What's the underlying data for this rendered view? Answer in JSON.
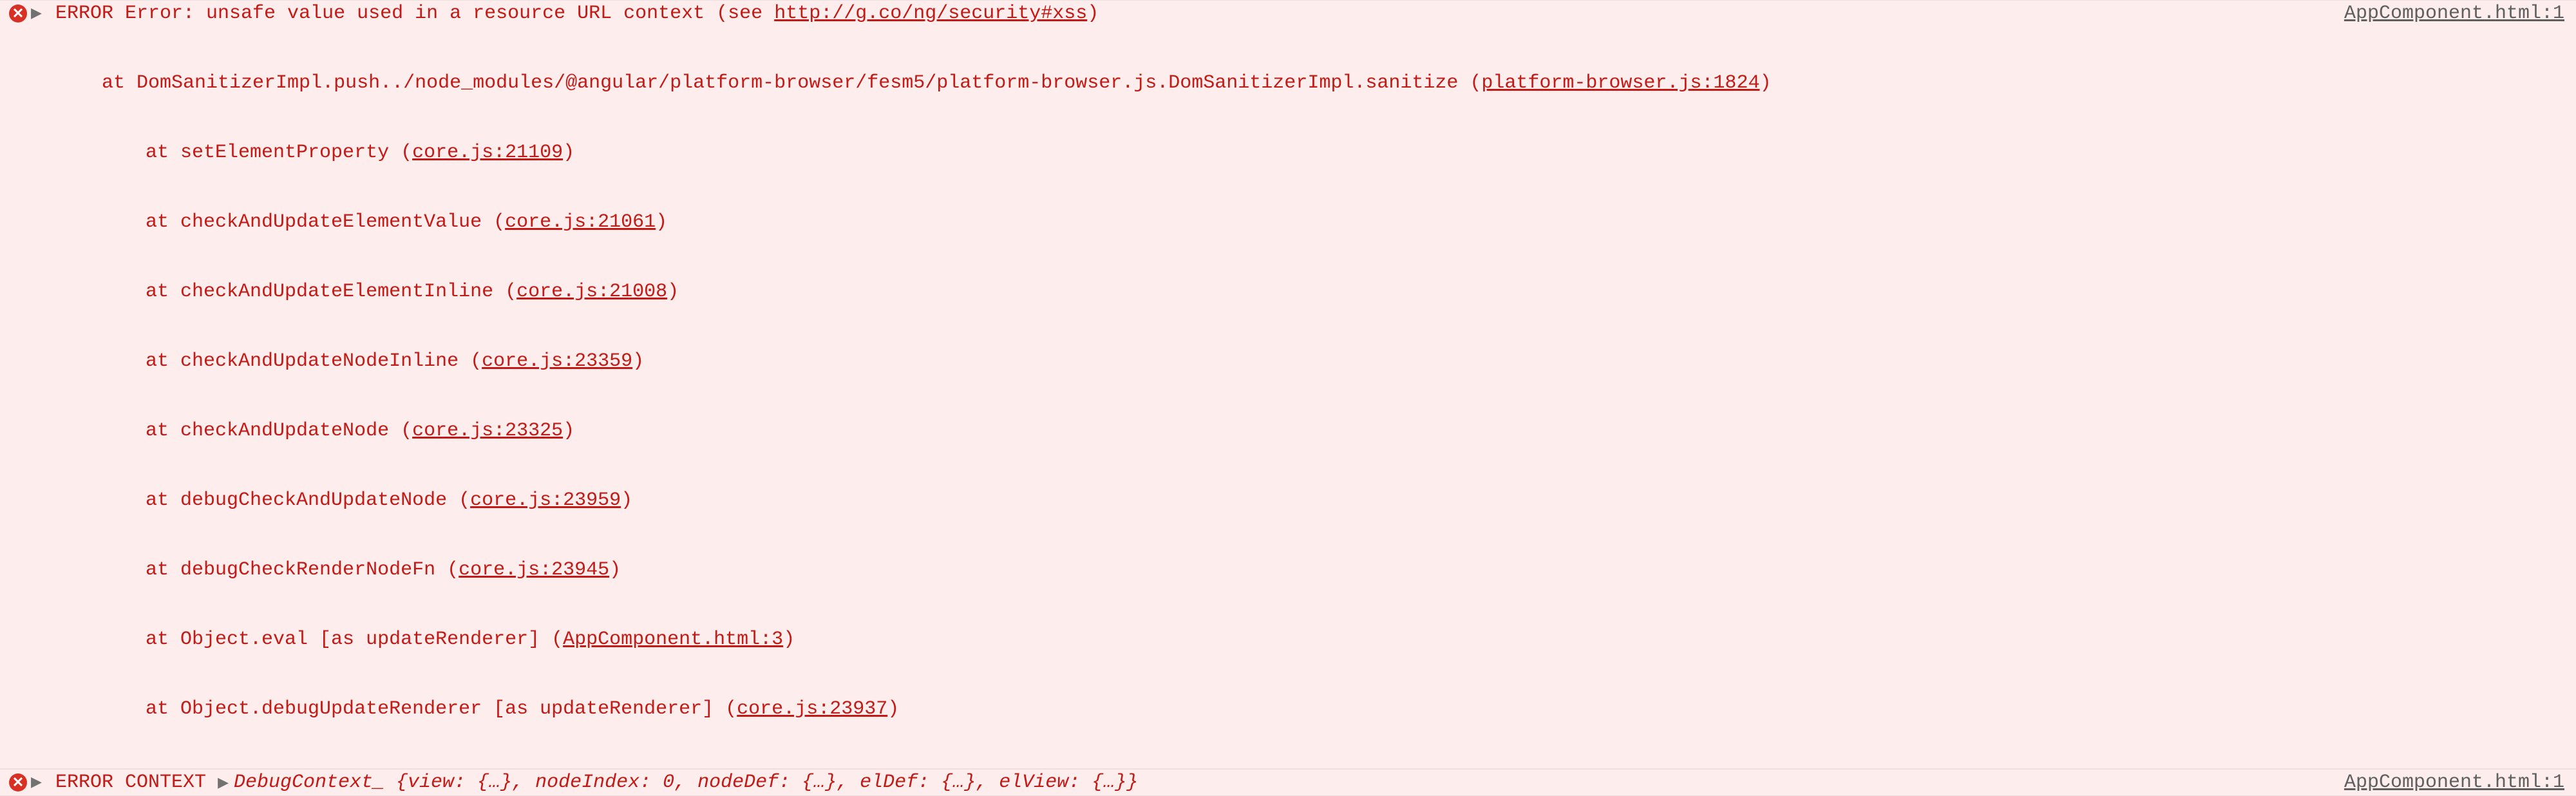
{
  "errors": [
    {
      "source": "AppComponent.html:1",
      "label": "ERROR",
      "head_a": " Error: unsafe value used in a resource URL context (see ",
      "head_link": "http://g.co/ng/security#xss",
      "head_b": ")",
      "wrap_a": "    at DomSanitizerImpl.push../node_modules/@angular/platform-browser/fesm5/platform-browser.js.DomSanitizerImpl.sanitize (",
      "wrap_link": "platform-browser.js:1824",
      "wrap_b": ")",
      "trace": [
        {
          "at": "    at setElementProperty (",
          "link": "core.js:21109",
          "tail": ")"
        },
        {
          "at": "    at checkAndUpdateElementValue (",
          "link": "core.js:21061",
          "tail": ")"
        },
        {
          "at": "    at checkAndUpdateElementInline (",
          "link": "core.js:21008",
          "tail": ")"
        },
        {
          "at": "    at checkAndUpdateNodeInline (",
          "link": "core.js:23359",
          "tail": ")"
        },
        {
          "at": "    at checkAndUpdateNode (",
          "link": "core.js:23325",
          "tail": ")"
        },
        {
          "at": "    at debugCheckAndUpdateNode (",
          "link": "core.js:23959",
          "tail": ")"
        },
        {
          "at": "    at debugCheckRenderNodeFn (",
          "link": "core.js:23945",
          "tail": ")"
        },
        {
          "at": "    at Object.eval [as updateRenderer] (",
          "link": "AppComponent.html:3",
          "tail": ")"
        },
        {
          "at": "    at Object.debugUpdateRenderer [as updateRenderer] (",
          "link": "core.js:23937",
          "tail": ")"
        }
      ]
    },
    {
      "source": "AppComponent.html:1",
      "label": "ERROR CONTEXT",
      "obj_class": "DebugContext_",
      "obj_text_a": " {view: {…}, nodeIndex: ",
      "obj_num": "0",
      "obj_text_b": ", nodeDef: {…}, elDef: {…}, elView: {…}}"
    }
  ]
}
